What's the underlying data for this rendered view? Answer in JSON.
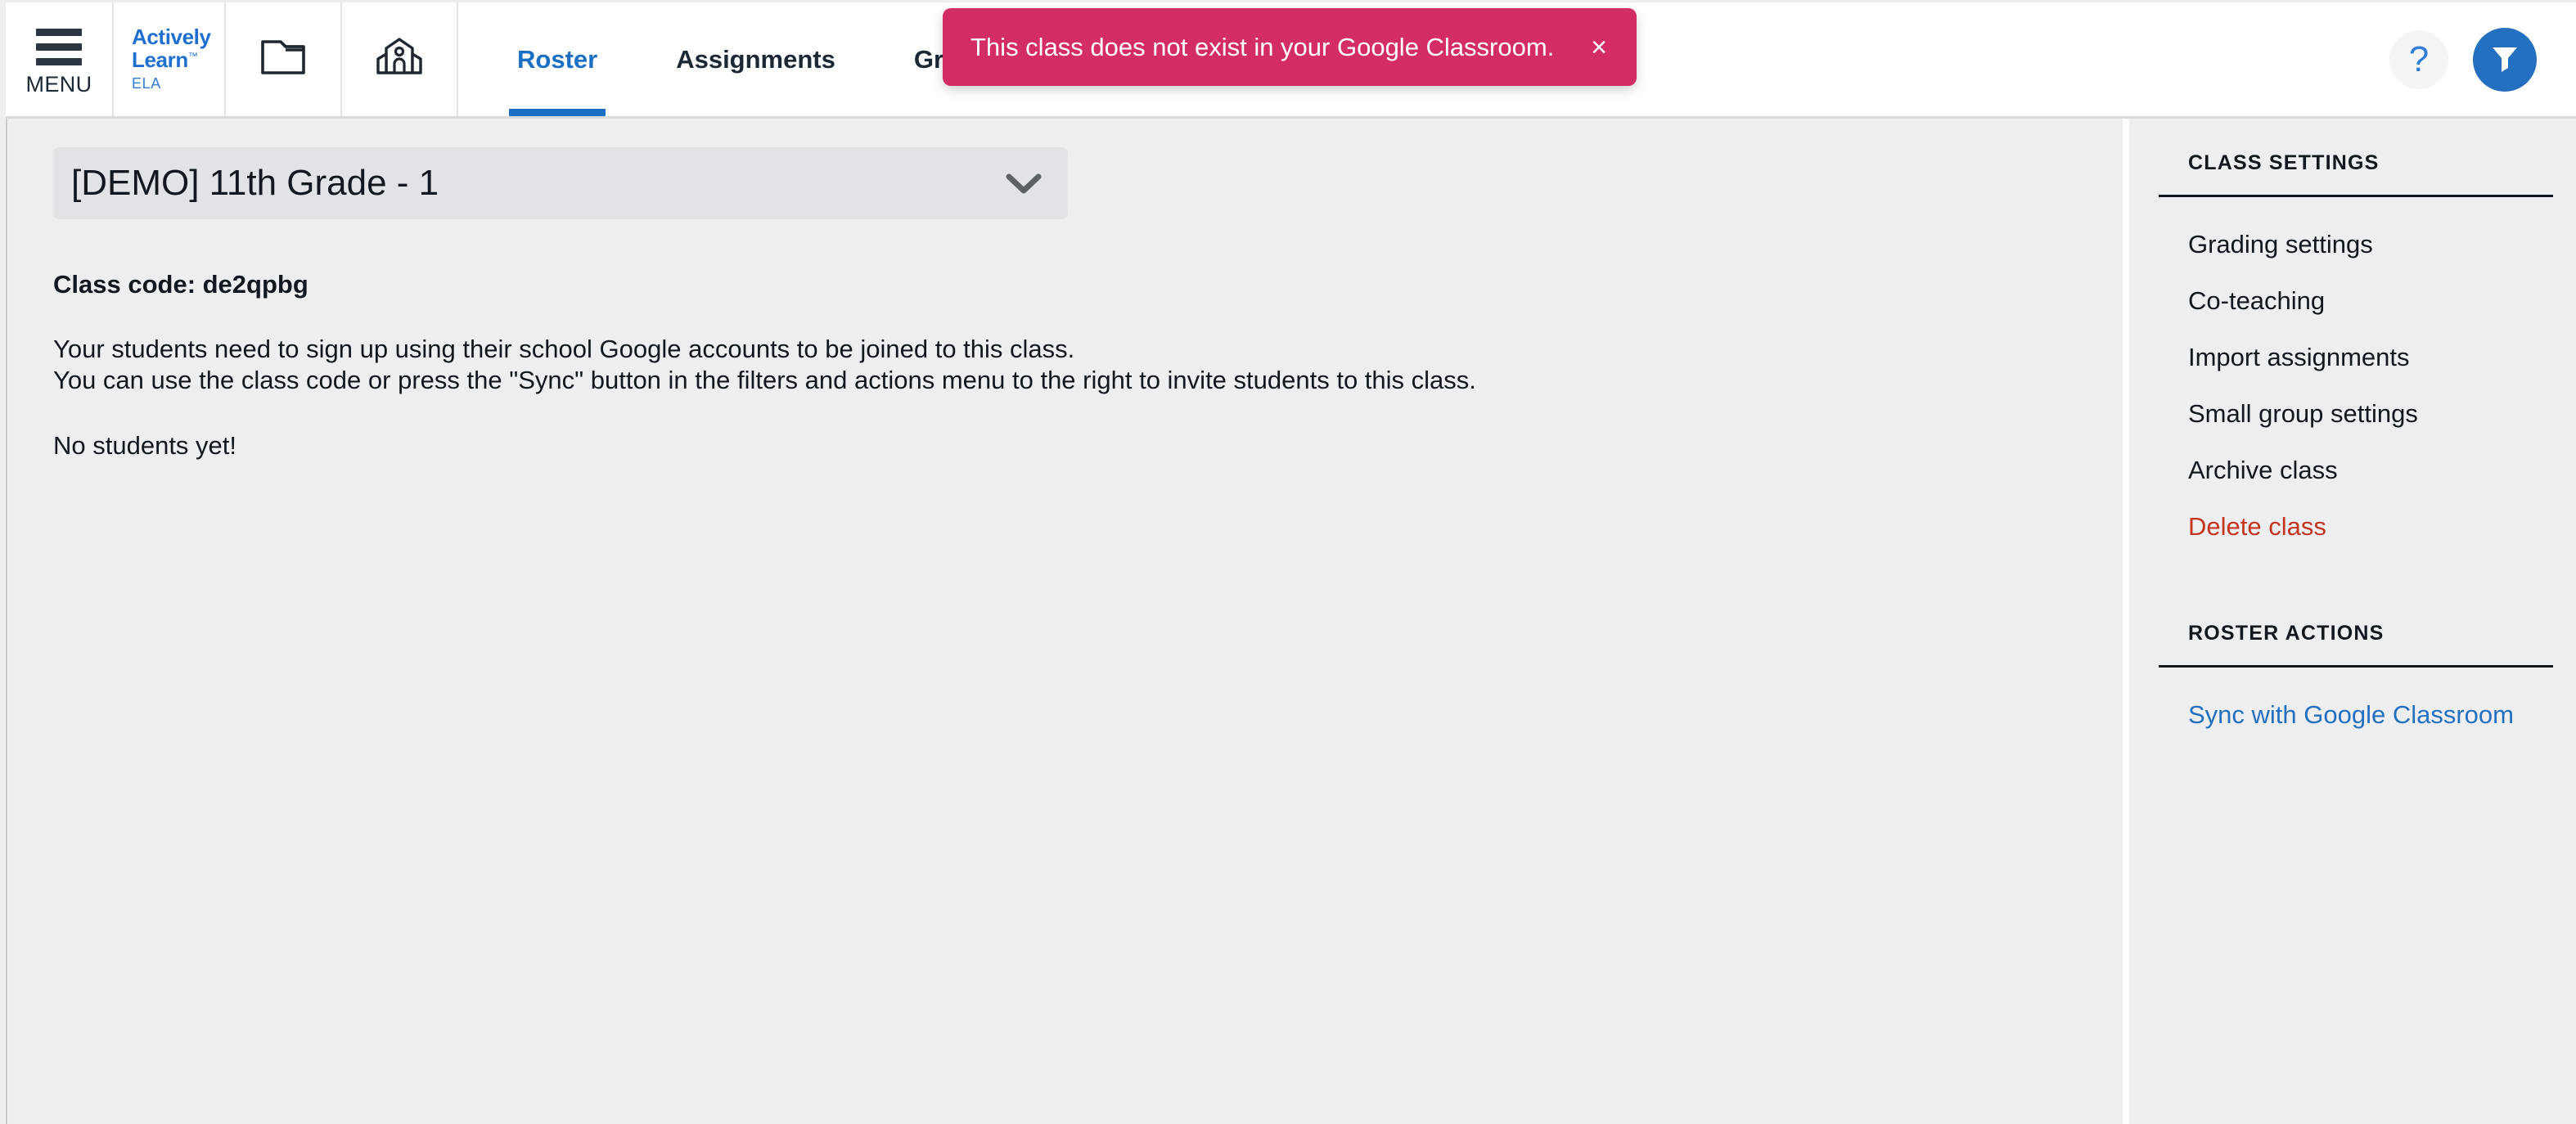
{
  "appbar": {
    "menu_label": "MENU",
    "menu_icon": "hamburger-menu-icon",
    "logo": {
      "line1": "Actively",
      "line2": "Learn",
      "tm": "™",
      "subject": "ELA",
      "color": "#1f6fd0"
    },
    "icons": [
      {
        "name": "library-folder-icon",
        "label": "Library"
      },
      {
        "name": "school-building-icon",
        "label": "School"
      }
    ],
    "tabs": [
      {
        "label": "Roster",
        "active": true
      },
      {
        "label": "Assignments",
        "active": false
      },
      {
        "label": "Grades",
        "active": false
      }
    ],
    "active_tab_color": "#1a6fc4",
    "help_label": "?",
    "help_icon": "question-mark-icon",
    "filter_icon": "funnel-filter-icon",
    "filter_button_color": "#2470c0"
  },
  "toast": {
    "message": "This class does not exist in your Google Classroom.",
    "close_label": "×",
    "background": "#d32d63",
    "text_color": "#ffffff"
  },
  "main": {
    "class_selector": {
      "value": "[DEMO] 11th Grade - 1",
      "chevron_icon": "chevron-down-icon"
    },
    "class_code_line": "Class code: de2qpbg",
    "info_lines": [
      "Your students need to sign up using their school Google accounts to be joined to this class.",
      "You can use the class code or press the \"Sync\" button in the filters and actions menu to the right to invite students to this class."
    ],
    "empty_state": "No students yet!"
  },
  "sidebar": {
    "class_settings": {
      "heading": "CLASS SETTINGS",
      "items": [
        {
          "label": "Grading settings",
          "style": "normal"
        },
        {
          "label": "Co-teaching",
          "style": "normal"
        },
        {
          "label": "Import assignments",
          "style": "normal"
        },
        {
          "label": "Small group settings",
          "style": "normal"
        },
        {
          "label": "Archive class",
          "style": "normal"
        },
        {
          "label": "Delete class",
          "style": "danger",
          "color": "#c3351f"
        }
      ]
    },
    "roster_actions": {
      "heading": "ROSTER ACTIONS",
      "items": [
        {
          "label": "Sync with Google Classroom",
          "style": "link",
          "color": "#2470c0"
        }
      ]
    }
  }
}
